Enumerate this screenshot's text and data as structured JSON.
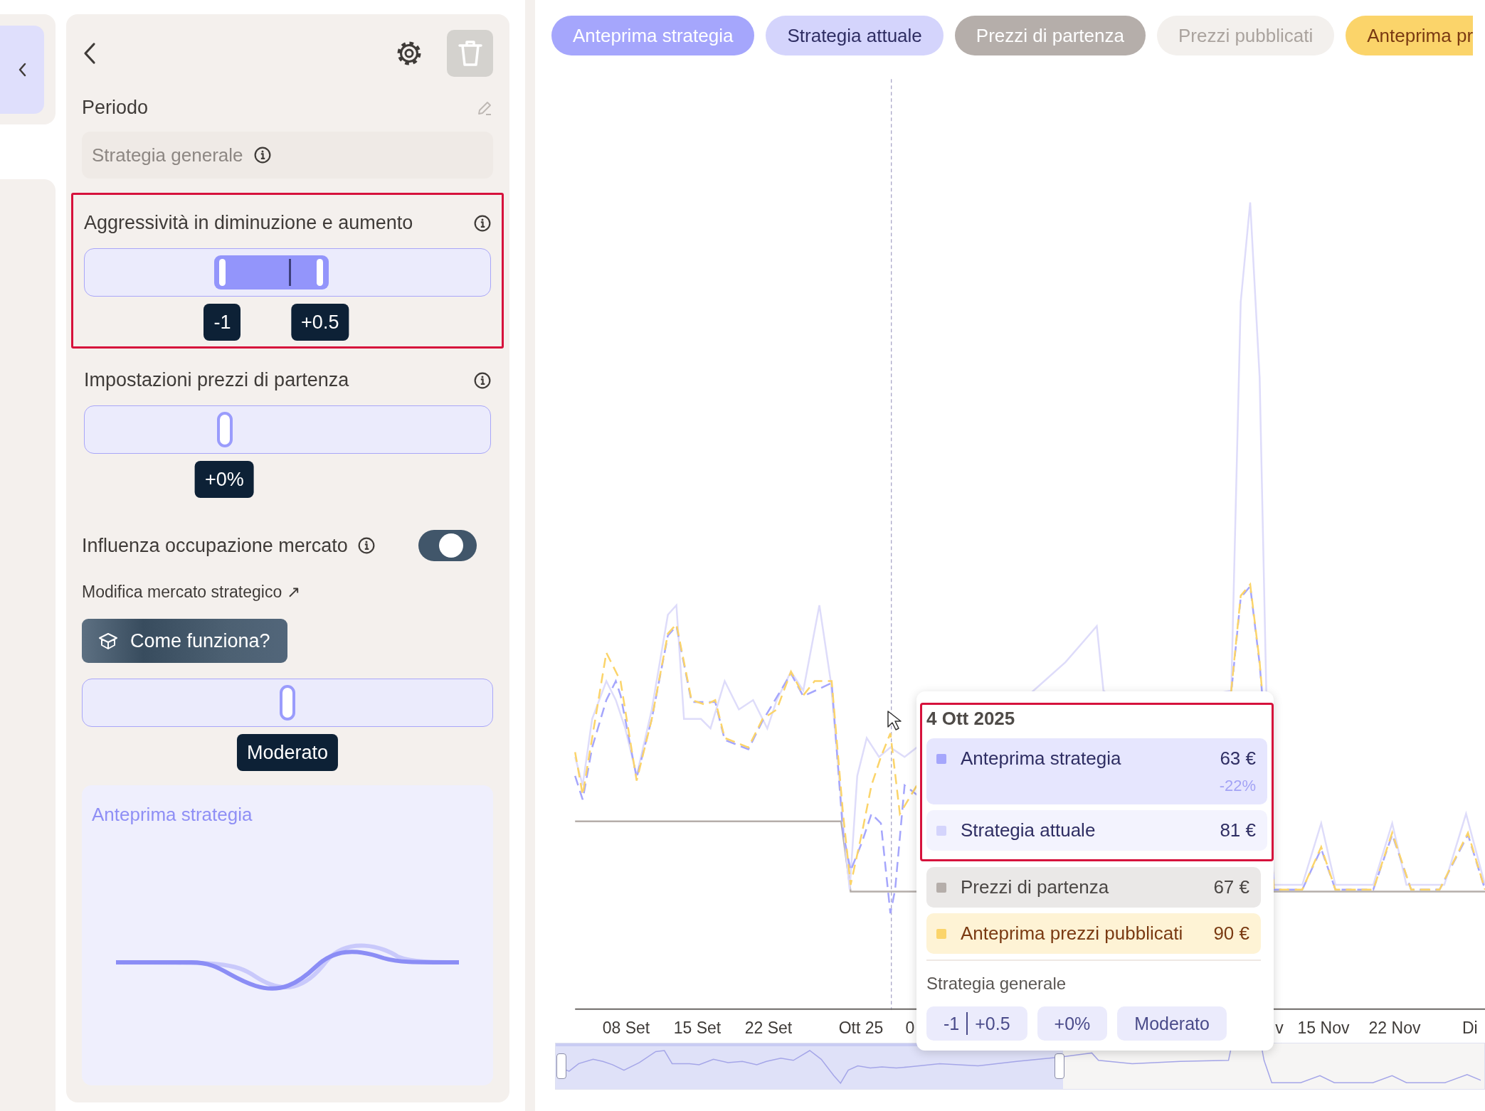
{
  "panel": {
    "title": "Periodo",
    "period_field": {
      "value": "Strategia generale",
      "disabled": true
    },
    "aggressiveness": {
      "title": "Aggressività in diminuzione e aumento",
      "highlighted": true,
      "handles": [
        {
          "level": 0.34,
          "reading": "-1"
        },
        {
          "level": 0.58,
          "reading": "+0.5"
        }
      ]
    },
    "base_prices": {
      "title": "Impostazioni prezzi di partenza",
      "highlighted": false,
      "level": 0.345,
      "reading": "+0%"
    },
    "market_influence": {
      "label": "Influenza occupazione mercato",
      "on": true
    },
    "market_link": "Modifica mercato strategico ↗",
    "help_button": "Come funziona?",
    "market_slider": {
      "level": 0.5,
      "reading": "Moderato"
    },
    "preview_card": {
      "title": "Anteprima strategia"
    }
  },
  "chart": {
    "legend": [
      {
        "label": "Anteprima strategia",
        "color": "#a5a6fc",
        "active": true
      },
      {
        "label": "Strategia attuale",
        "color": "#d4d4fc",
        "active": true
      },
      {
        "label": "Prezzi di partenza",
        "color": "#b5aeaa",
        "active": true
      },
      {
        "label": "Prezzi pubblicati",
        "color": "#f3f0ed",
        "active": false
      },
      {
        "label": "Anteprima pr",
        "color": "#fbd46a",
        "active": true
      }
    ],
    "x_labels": [
      "08 Set",
      "15 Set",
      "22 Set",
      "Ott 25",
      "0",
      "v",
      "15 Nov",
      "22 Nov",
      "Di"
    ],
    "tooltip": {
      "date": "4 Ott 2025",
      "rows": [
        {
          "label": "Anteprima strategia",
          "value": "63 €",
          "change": "-22%",
          "color": "#a5a6fc",
          "highlighted": true
        },
        {
          "label": "Strategia attuale",
          "value": "81 €",
          "color": "#d4d4fc",
          "highlighted": true
        },
        {
          "label": "Prezzi di partenza",
          "value": "67 €",
          "color": "#b5aeaa",
          "highlighted": false
        },
        {
          "label": "Anteprima prezzi pubblicati",
          "value": "90 €",
          "color": "#fbd46a",
          "highlighted": false
        }
      ],
      "strategy_title": "Strategia generale",
      "chips": [
        {
          "parts": [
            "-1",
            "+0.5"
          ]
        },
        {
          "parts": [
            "+0%"
          ]
        },
        {
          "parts": [
            "Moderato"
          ]
        }
      ]
    }
  }
}
